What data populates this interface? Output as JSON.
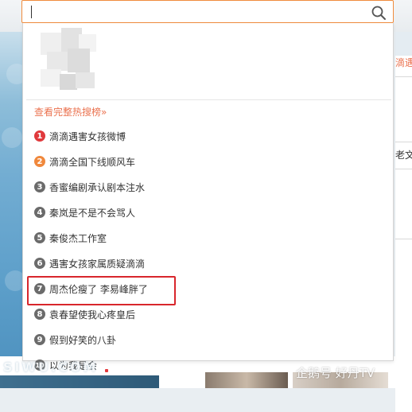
{
  "search": {
    "value": "",
    "placeholder": ""
  },
  "dropdown": {
    "more_link": "查看完整热搜榜»",
    "items": [
      {
        "rank": "1",
        "label": "滴滴遇害女孩微博",
        "badge_color": "#e0393c"
      },
      {
        "rank": "2",
        "label": "滴滴全国下线顺风车",
        "badge_color": "#f0883c"
      },
      {
        "rank": "3",
        "label": "香蜜编剧承认剧本注水",
        "badge_color": "#6b6b6b"
      },
      {
        "rank": "4",
        "label": "秦岚是不是不会骂人",
        "badge_color": "#6b6b6b"
      },
      {
        "rank": "5",
        "label": "秦俊杰工作室",
        "badge_color": "#6b6b6b"
      },
      {
        "rank": "6",
        "label": "遇害女孩家属质疑滴滴",
        "badge_color": "#6b6b6b"
      },
      {
        "rank": "7",
        "label": "周杰伦瘦了 李易峰胖了",
        "badge_color": "#6b6b6b"
      },
      {
        "rank": "8",
        "label": "袁春望使我心疼皇后",
        "badge_color": "#6b6b6b"
      },
      {
        "rank": "9",
        "label": "假到好笑的八卦",
        "badge_color": "#6b6b6b"
      },
      {
        "rank": "10",
        "label": "以为我是会",
        "badge_color": "#6b6b6b"
      }
    ]
  },
  "background": {
    "right_text_1": "滴遇害",
    "right_text_2": "老文章"
  },
  "watermarks": {
    "left": "SIWU.COM",
    "right": "企鹅号 好丹TV"
  },
  "colors": {
    "accent": "#eb7350",
    "search_border": "#f08c3d",
    "highlight": "#d8262c"
  }
}
